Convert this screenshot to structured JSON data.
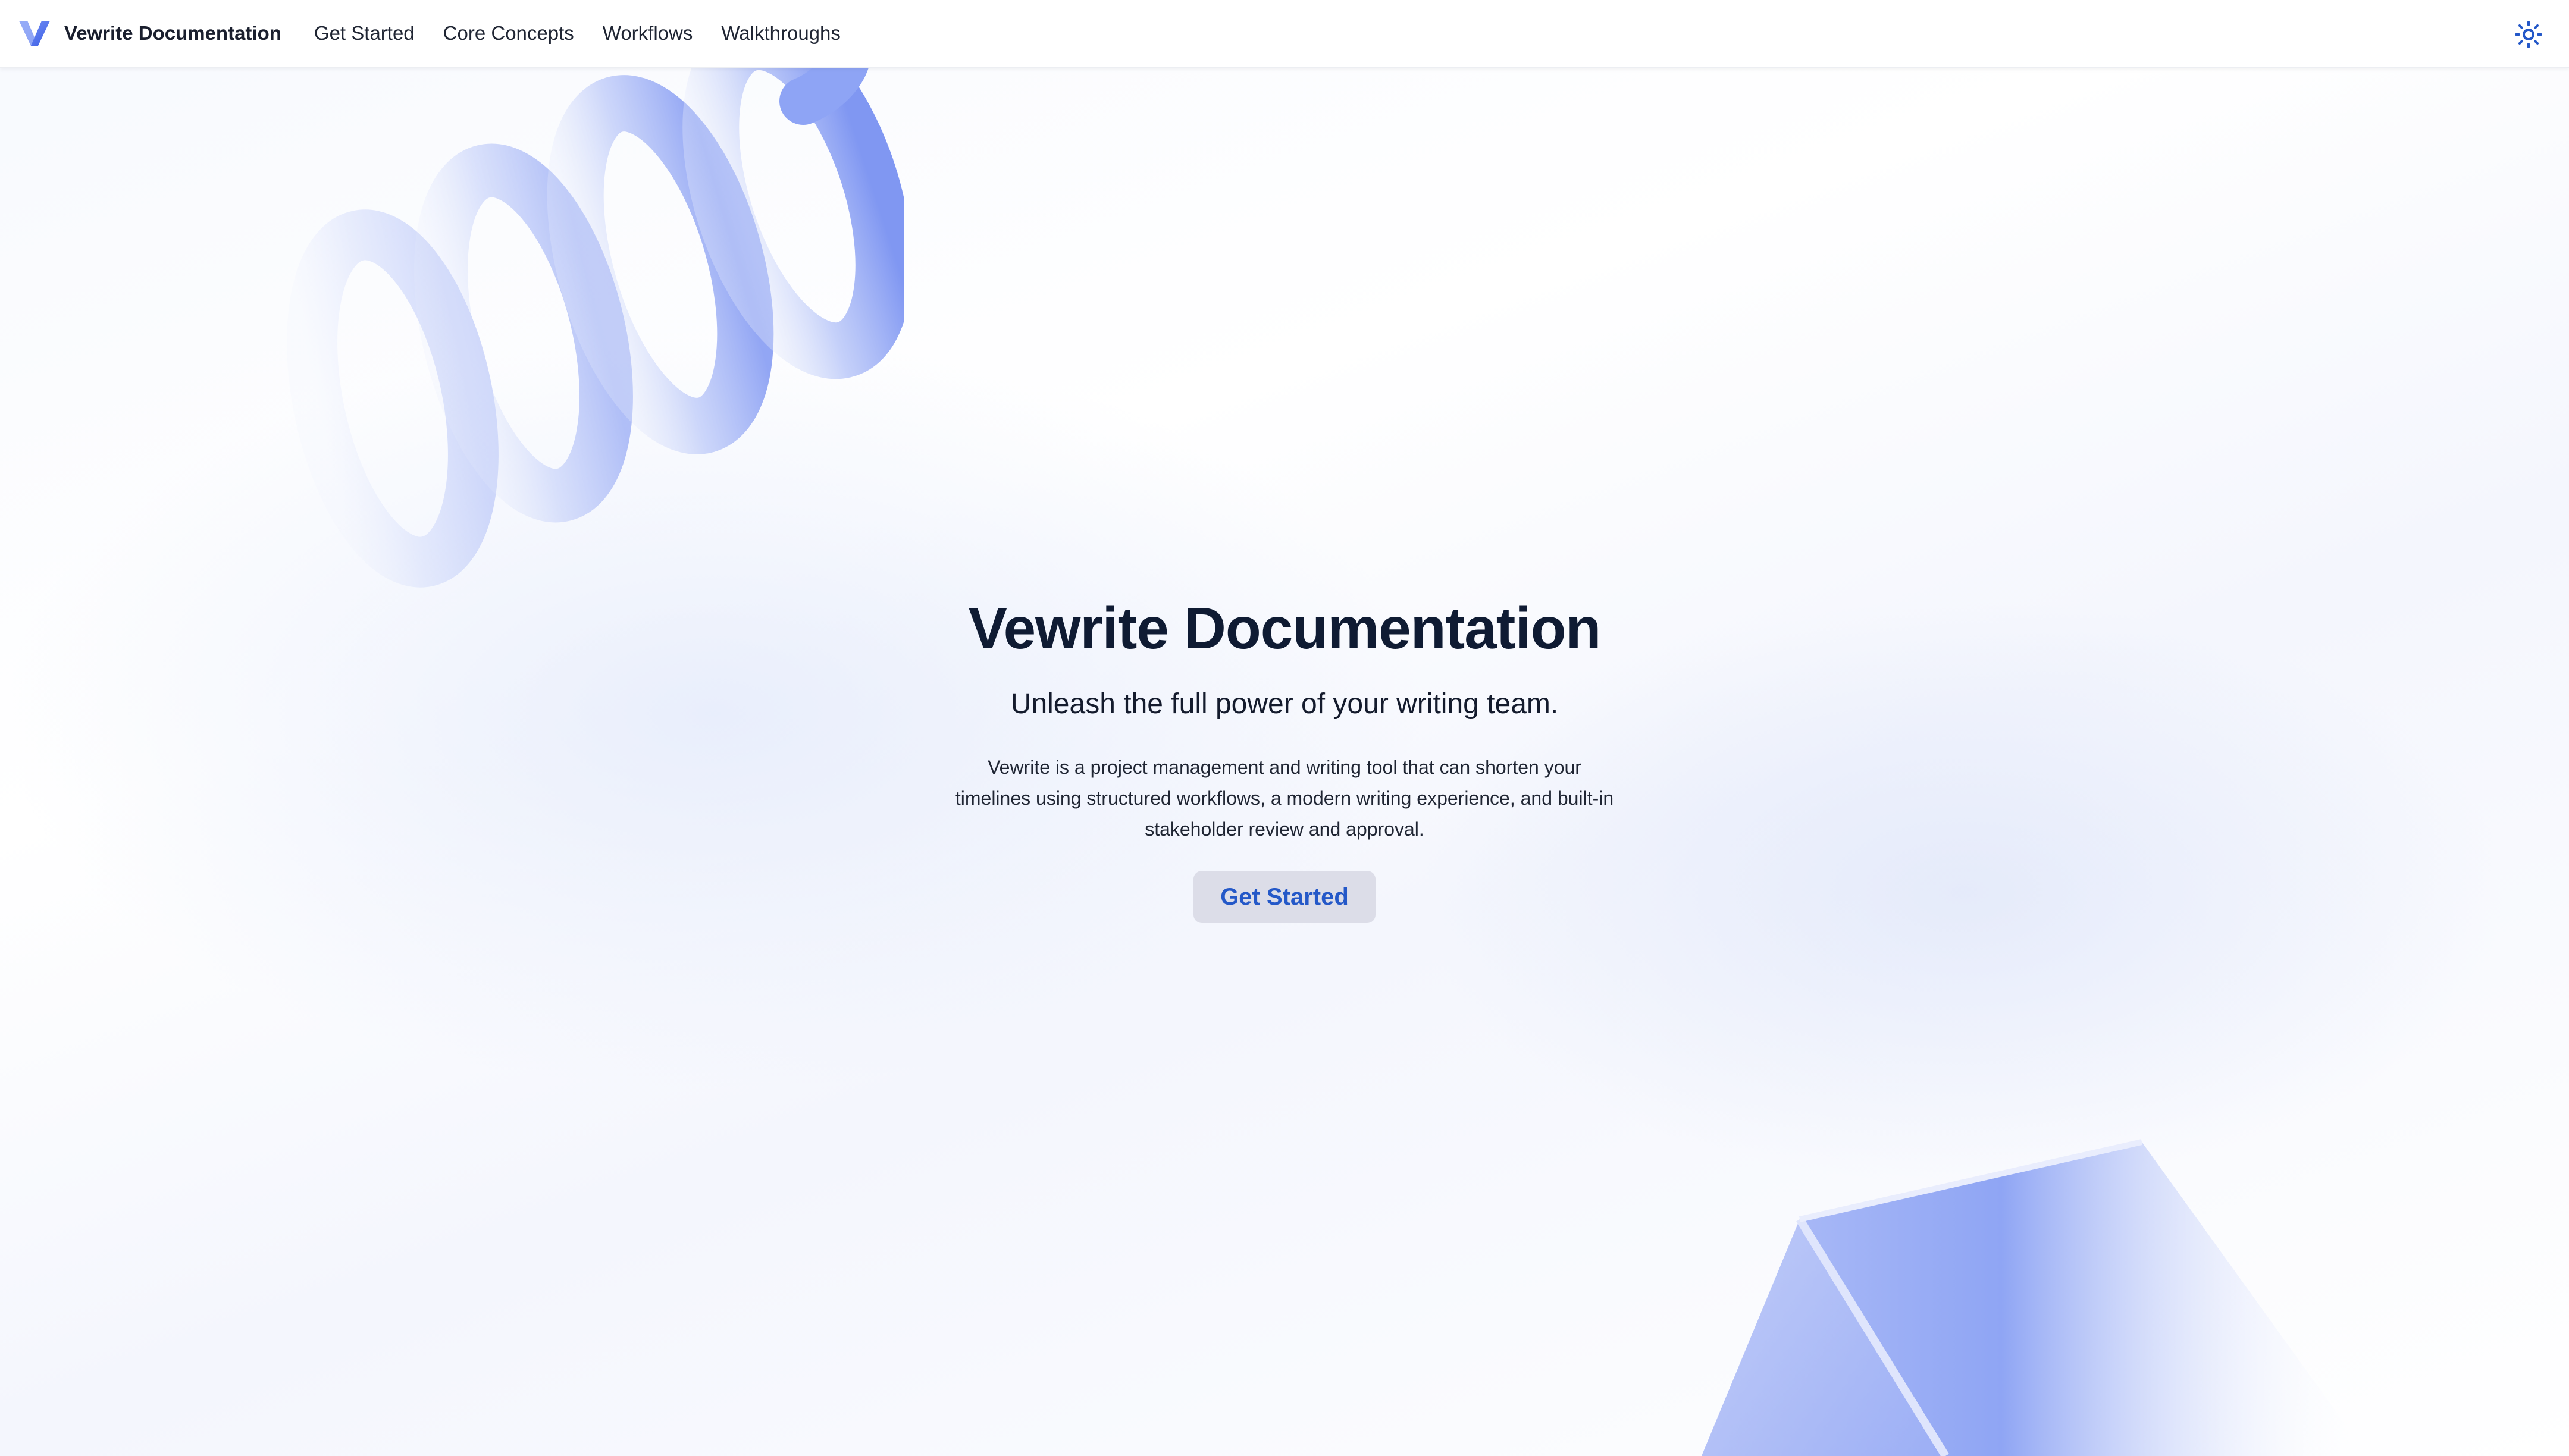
{
  "navbar": {
    "brand": "Vewrite Documentation",
    "links": [
      "Get Started",
      "Core Concepts",
      "Workflows",
      "Walkthroughs"
    ]
  },
  "hero": {
    "title": "Vewrite Documentation",
    "tagline": "Unleash the full power of your writing team.",
    "description": "Vewrite is a project management and writing tool that can shorten your timelines using structured workflows, a modern writing experience, and built-in stakeholder review and approval.",
    "cta": "Get Started"
  },
  "icons": {
    "logo": "vewrite-logo",
    "theme_toggle": "sun-icon",
    "decor_top": "spiral-coil-shape",
    "decor_bottom": "pyramid-shape"
  },
  "colors": {
    "accent": "#2458c8",
    "logo_blue": "#4a6ff0",
    "shape_blue": "#8ea4f5",
    "title_text": "#0f1b33",
    "cta_background": "#dcdde8"
  }
}
